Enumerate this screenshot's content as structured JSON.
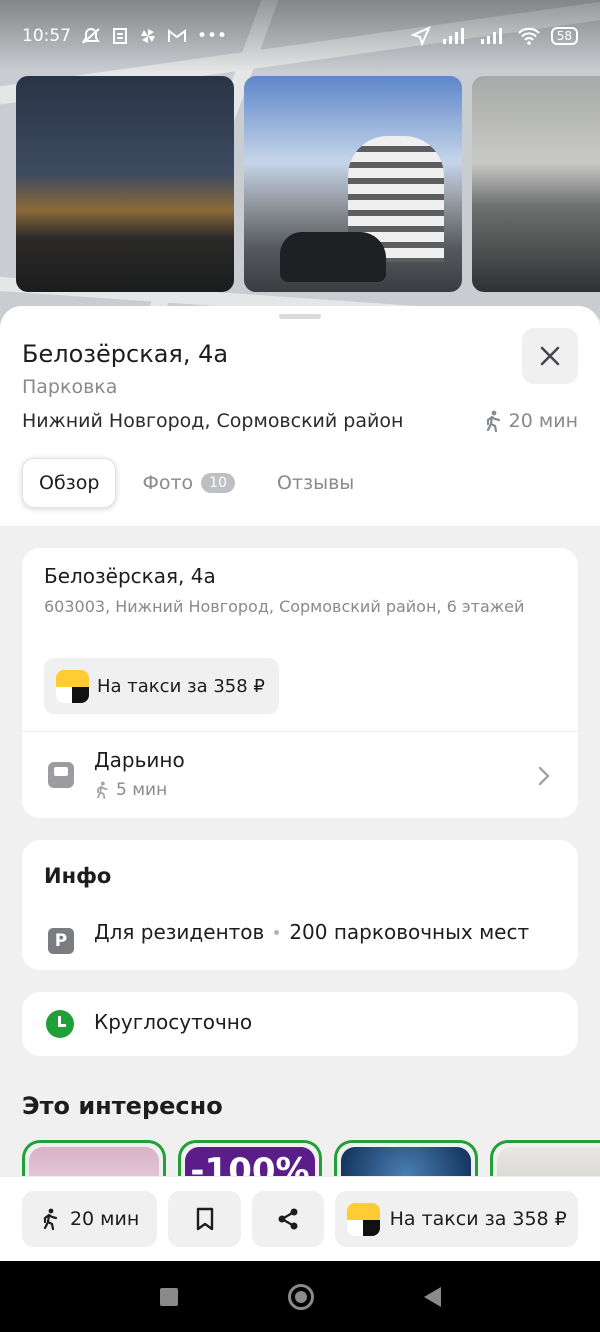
{
  "status_bar": {
    "time": "10:57",
    "battery": "58"
  },
  "place": {
    "title": "Белозёрская, 4а",
    "category": "Парковка",
    "locality": "Нижний Новгород, Сормовский район",
    "walk_time": "20 мин"
  },
  "tabs": [
    {
      "label": "Обзор",
      "active": true
    },
    {
      "label": "Фото",
      "count": "10",
      "active": false
    },
    {
      "label": "Отзывы",
      "active": false
    }
  ],
  "address_card": {
    "title": "Белозёрская, 4а",
    "full_address": "603003, Нижний Новгород, Сормовский район, 6 этажей",
    "taxi_label": "На такси за 358 ₽",
    "stop_name": "Дарьино",
    "stop_walk": "5 мин"
  },
  "info_card": {
    "heading": "Инфо",
    "access": "Для резидентов",
    "capacity": "200 парковочных мест"
  },
  "hours_card": {
    "label": "Круглосуточно"
  },
  "interest": {
    "heading": "Это интересно",
    "promo_text": "-100%"
  },
  "actions": {
    "walk_label": "20 мин",
    "taxi_label": "На такси за 358 ₽"
  },
  "colors": {
    "accent_green": "#21a038",
    "taxi_yellow": "#ffcc33"
  },
  "icons": [
    "walk-icon",
    "close-icon",
    "bus-icon",
    "chevron-right-icon",
    "parking-icon",
    "clock-icon",
    "bookmark-icon",
    "share-icon",
    "taxi-icon"
  ]
}
